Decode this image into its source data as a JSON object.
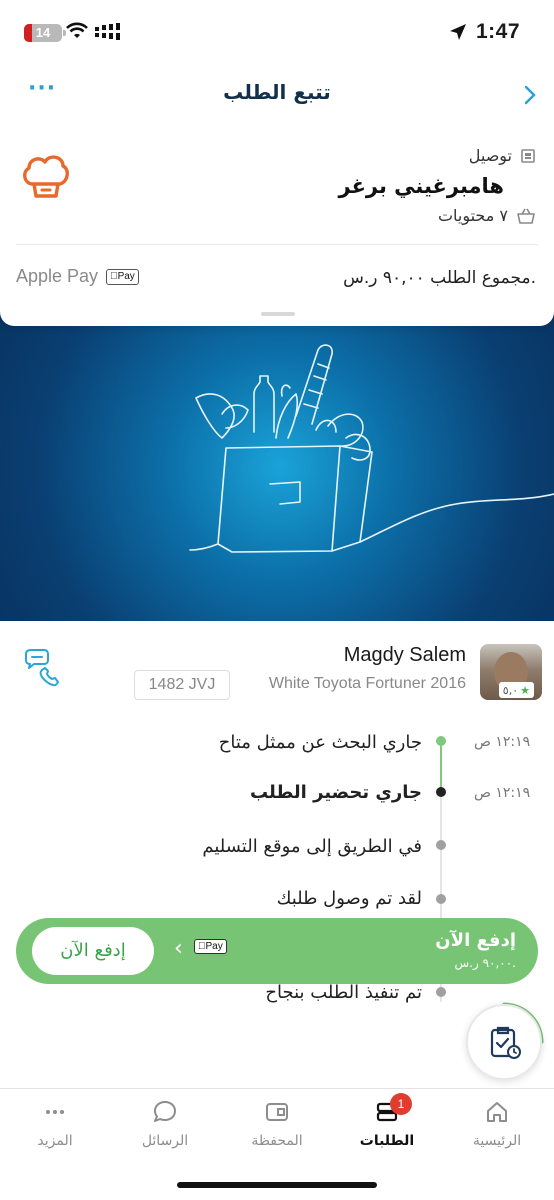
{
  "status_bar": {
    "time": "1:47",
    "battery": "14"
  },
  "header": {
    "title": "تتبع الطلب",
    "more": "···"
  },
  "order": {
    "delivery_label": "توصيل",
    "store_name": "هامبرغيني برغر",
    "items_count": "٧ محتويات",
    "total": "مجموع الطلب ٩٠,٠٠ ر.س.",
    "payment_method": "Apple Pay",
    "pay_badge": "Pay"
  },
  "courier": {
    "name": "Magdy Salem",
    "car": "White Toyota Fortuner 2016",
    "plate": "1482 JVJ",
    "rating": "٥,٠"
  },
  "timeline": [
    {
      "label": "جاري البحث عن ممثل متاح",
      "time": "١٢:١٩ ص",
      "state": "done"
    },
    {
      "label": "جاري تحضير الطلب",
      "time": "١٢:١٩ ص",
      "state": "current"
    },
    {
      "label": "في الطريق إلى موقع التسليم",
      "time": "",
      "state": "pending"
    },
    {
      "label": "لقد تم وصول طلبك",
      "time": "",
      "state": "pending"
    },
    {
      "label": "تم تنفيذ الطلب بنجاح",
      "time": "",
      "state": "pending"
    }
  ],
  "pay_bar": {
    "title": "إدفع الآن",
    "amount": "٩٠,٠٠ ر.س.",
    "badge": "Pay",
    "button": "إدفع الآن"
  },
  "nav": {
    "home": "الرئيسية",
    "orders": "الطلبات",
    "orders_badge": "1",
    "wallet": "المحفظة",
    "messages": "الرسائل",
    "more": "المزيد"
  },
  "colors": {
    "accent": "#2a9fd6",
    "green": "#77c474",
    "chef_orange": "#e8692c",
    "banner_dark": "#0a3f72",
    "badge_red": "#e23b2f"
  },
  "icons": [
    "location-arrow-icon",
    "wifi-icon",
    "signal-icon",
    "battery-icon",
    "back-chevron-icon",
    "more-dots-icon",
    "chef-hat-icon",
    "delivery-icon",
    "basket-icon",
    "apple-pay-icon",
    "call-chat-icon",
    "star-icon",
    "chevron-left-icon",
    "order-history-icon",
    "home-icon",
    "orders-icon",
    "wallet-icon",
    "messages-icon",
    "more-icon"
  ]
}
